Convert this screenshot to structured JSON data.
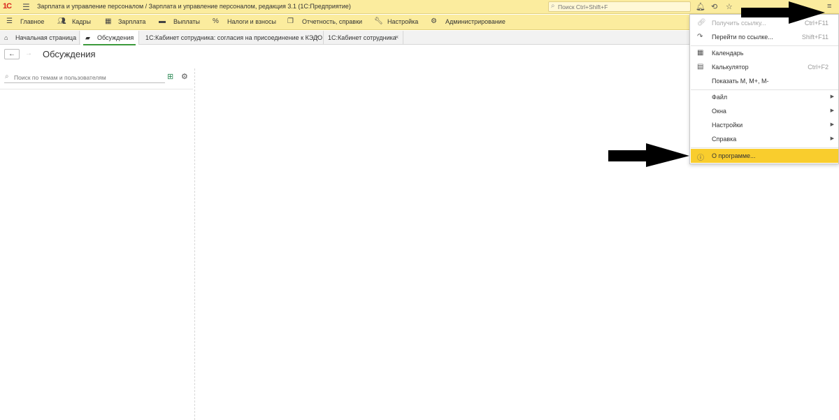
{
  "titlebar": {
    "logo": "1С",
    "title": "Зарплата и управление персоналом / Зарплата и управление персоналом, редакция 3.1  (1С:Предприятие)",
    "search_placeholder": "Поиск Ctrl+Shift+F"
  },
  "sections": [
    {
      "label": "Главное",
      "icon": "menu-lines-icon"
    },
    {
      "label": "Кадры",
      "icon": "people-icon"
    },
    {
      "label": "Зарплата",
      "icon": "calculator-icon"
    },
    {
      "label": "Выплаты",
      "icon": "card-icon"
    },
    {
      "label": "Налоги и взносы",
      "icon": "percent-icon"
    },
    {
      "label": "Отчетность, справки",
      "icon": "reports-icon"
    },
    {
      "label": "Настройка",
      "icon": "wrench-icon"
    },
    {
      "label": "Администрирование",
      "icon": "gear-icon"
    }
  ],
  "tabs": [
    {
      "label": "Начальная страница",
      "icon": "home-icon"
    },
    {
      "label": "Обсуждения",
      "icon": "discussions-icon"
    },
    {
      "label": "1С:Кабинет сотрудника: согласия на присоединение к КЭДО"
    },
    {
      "label": "1С:Кабинет сотрудника"
    }
  ],
  "page": {
    "title": "Обсуждения",
    "search_placeholder": "Поиск по темам и пользователям"
  },
  "menu": {
    "items": [
      {
        "label": "Получить ссылку...",
        "shortcut": "Ctrl+F11",
        "icon": "link-icon",
        "disabled": true
      },
      {
        "label": "Перейти по ссылке...",
        "shortcut": "Shift+F11",
        "icon": "goto-link-icon"
      },
      {
        "label": "Календарь",
        "icon": "calendar-icon"
      },
      {
        "label": "Калькулятор",
        "shortcut": "Ctrl+F2",
        "icon": "calculator-icon"
      },
      {
        "label": "Показать M, M+, M-"
      },
      {
        "label": "Файл",
        "submenu": true
      },
      {
        "label": "Окна",
        "submenu": true
      },
      {
        "label": "Настройки",
        "submenu": true
      },
      {
        "label": "Справка",
        "submenu": true
      },
      {
        "label": "О программе...",
        "icon": "info-icon",
        "highlighted": true
      }
    ]
  },
  "colors": {
    "header_bg": "#fbec9e",
    "highlight": "#f9cd2d",
    "active_tab_underline": "#3c9a3c"
  }
}
